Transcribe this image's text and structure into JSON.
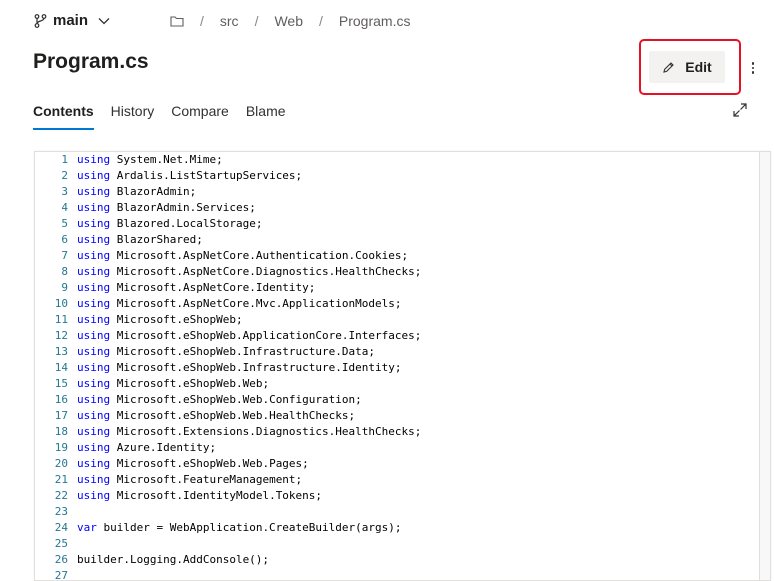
{
  "header": {
    "branch": "main",
    "breadcrumb": [
      "src",
      "Web",
      "Program.cs"
    ],
    "title": "Program.cs",
    "edit_label": "Edit"
  },
  "tabs": [
    {
      "label": "Contents",
      "active": true
    },
    {
      "label": "History",
      "active": false
    },
    {
      "label": "Compare",
      "active": false
    },
    {
      "label": "Blame",
      "active": false
    }
  ],
  "colors": {
    "accent": "#0078d4",
    "highlight": "#e81123",
    "keyword": "#0000ff",
    "line_number": "#237893"
  },
  "code": {
    "lines": [
      {
        "n": "1",
        "kw": "using",
        "text": " System.Net.Mime;"
      },
      {
        "n": "2",
        "kw": "using",
        "text": " Ardalis.ListStartupServices;"
      },
      {
        "n": "3",
        "kw": "using",
        "text": " BlazorAdmin;"
      },
      {
        "n": "4",
        "kw": "using",
        "text": " BlazorAdmin.Services;"
      },
      {
        "n": "5",
        "kw": "using",
        "text": " Blazored.LocalStorage;"
      },
      {
        "n": "6",
        "kw": "using",
        "text": " BlazorShared;"
      },
      {
        "n": "7",
        "kw": "using",
        "text": " Microsoft.AspNetCore.Authentication.Cookies;"
      },
      {
        "n": "8",
        "kw": "using",
        "text": " Microsoft.AspNetCore.Diagnostics.HealthChecks;"
      },
      {
        "n": "9",
        "kw": "using",
        "text": " Microsoft.AspNetCore.Identity;"
      },
      {
        "n": "10",
        "kw": "using",
        "text": " Microsoft.AspNetCore.Mvc.ApplicationModels;"
      },
      {
        "n": "11",
        "kw": "using",
        "text": " Microsoft.eShopWeb;"
      },
      {
        "n": "12",
        "kw": "using",
        "text": " Microsoft.eShopWeb.ApplicationCore.Interfaces;"
      },
      {
        "n": "13",
        "kw": "using",
        "text": " Microsoft.eShopWeb.Infrastructure.Data;"
      },
      {
        "n": "14",
        "kw": "using",
        "text": " Microsoft.eShopWeb.Infrastructure.Identity;"
      },
      {
        "n": "15",
        "kw": "using",
        "text": " Microsoft.eShopWeb.Web;"
      },
      {
        "n": "16",
        "kw": "using",
        "text": " Microsoft.eShopWeb.Web.Configuration;"
      },
      {
        "n": "17",
        "kw": "using",
        "text": " Microsoft.eShopWeb.Web.HealthChecks;"
      },
      {
        "n": "18",
        "kw": "using",
        "text": " Microsoft.Extensions.Diagnostics.HealthChecks;"
      },
      {
        "n": "19",
        "kw": "using",
        "text": " Azure.Identity;"
      },
      {
        "n": "20",
        "kw": "using",
        "text": " Microsoft.eShopWeb.Web.Pages;"
      },
      {
        "n": "21",
        "kw": "using",
        "text": " Microsoft.FeatureManagement;"
      },
      {
        "n": "22",
        "kw": "using",
        "text": " Microsoft.IdentityModel.Tokens;"
      },
      {
        "n": "23",
        "kw": "",
        "text": ""
      },
      {
        "n": "24",
        "kw": "var",
        "text": " builder = WebApplication.CreateBuilder(args);"
      },
      {
        "n": "25",
        "kw": "",
        "text": ""
      },
      {
        "n": "26",
        "kw": "",
        "text": "builder.Logging.AddConsole();"
      },
      {
        "n": "27",
        "kw": "",
        "text": ""
      }
    ]
  }
}
